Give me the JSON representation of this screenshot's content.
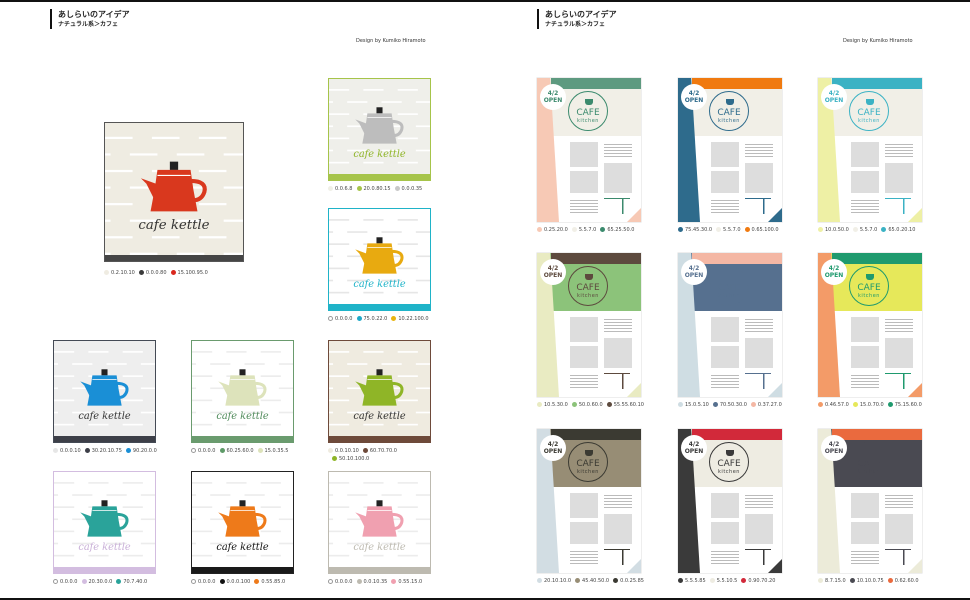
{
  "pages": [
    {
      "title": "あしらいのアイデア",
      "subtitle": "ナチュラル系＞カフェ",
      "credit": "Design by Kumiko Hiramoto"
    },
    {
      "title": "あしらいのアイデア",
      "subtitle": "ナチュラル系＞カフェ",
      "credit": "Design by Kumiko Hiramoto"
    }
  ],
  "kettle_text": "cafe kettle",
  "kettle_cards": [
    {
      "bg": "#efece2",
      "border": "#555555",
      "bar": "#454545",
      "stripe": "#ffffff",
      "kettle": "#d9381e",
      "text": "#333333",
      "big": true,
      "colors": [
        {
          "c": "#efece2",
          "v": "0.2.10.10"
        },
        {
          "c": "#3a3a3a",
          "v": "0.0.0.80"
        },
        {
          "c": "#d9281e",
          "v": "15.100.95.0"
        }
      ]
    },
    {
      "bg": "#efefea",
      "border": "#a6c44a",
      "bar": "#a6c44a",
      "stripe": "#ffffff",
      "kettle": "#bdbdbd",
      "text": "#8fb527",
      "colors": [
        {
          "c": "#efefe6",
          "v": "0.0.6.8"
        },
        {
          "c": "#a6c44a",
          "v": "20.0.80.15"
        },
        {
          "c": "#c8c8c8",
          "v": "0.0.0.35"
        }
      ]
    },
    {
      "bg": "#ffffff",
      "border": "#1fb3c8",
      "bar": "#1fb3c8",
      "stripe": "#e6e6e6",
      "kettle": "#e8aa10",
      "text": "#1fb3c8",
      "colors": [
        {
          "c": "#ffffff",
          "v": "0.0.0.0"
        },
        {
          "c": "#1fa8c8",
          "v": "75.0.22.0"
        },
        {
          "c": "#e8b410",
          "v": "10.22.100.0"
        }
      ]
    },
    {
      "bg": "#eeeeee",
      "border": "#444a55",
      "bar": "#3d3f48",
      "stripe": "#ffffff",
      "kettle": "#1a8fd6",
      "text": "#333333",
      "colors": [
        {
          "c": "#e6e6e6",
          "v": "0.0.0.10"
        },
        {
          "c": "#3d3f48",
          "v": "30.20.10.75"
        },
        {
          "c": "#1a8fd6",
          "v": "90.20.0.0"
        }
      ]
    },
    {
      "bg": "#ffffff",
      "border": "#6a9b6e",
      "bar": "#6a9b6e",
      "stripe": "#ececec",
      "kettle": "#dde3bb",
      "text": "#4f8a5a",
      "colors": [
        {
          "c": "#ffffff",
          "v": "0.0.0.0"
        },
        {
          "c": "#5e9a68",
          "v": "60.25.60.0"
        },
        {
          "c": "#dde3bb",
          "v": "15.0.35.5"
        }
      ]
    },
    {
      "bg": "#efebe0",
      "border": "#6e4a3a",
      "bar": "#6e4a3a",
      "stripe": "#ffffff",
      "kettle": "#8fb527",
      "text": "#333333",
      "colors": [
        {
          "c": "#efebe0",
          "v": "0.0.10.10"
        },
        {
          "c": "#6e4a3a",
          "v": "60.70.70.0"
        },
        {
          "c": "#8fb527",
          "v": "50.10.100.0"
        }
      ]
    },
    {
      "bg": "#ffffff",
      "border": "#d3bde0",
      "bar": "#d3bde0",
      "stripe": "#ececec",
      "kettle": "#2aa39a",
      "text": "#c9b0d8",
      "colors": [
        {
          "c": "#ffffff",
          "v": "0.0.0.0"
        },
        {
          "c": "#d3bde0",
          "v": "20.30.0.0"
        },
        {
          "c": "#2aa39a",
          "v": "70.7.40.0"
        }
      ]
    },
    {
      "bg": "#ffffff",
      "border": "#222222",
      "bar": "#1a1a1a",
      "stripe": "#ececec",
      "kettle": "#ee7a1a",
      "text": "#111111",
      "colors": [
        {
          "c": "#ffffff",
          "v": "0.0.0.0"
        },
        {
          "c": "#111111",
          "v": "0.0.0.100"
        },
        {
          "c": "#ee7a1a",
          "v": "0.55.85.0"
        }
      ]
    },
    {
      "bg": "#ffffff",
      "border": "#bdbab0",
      "bar": "#bdbab0",
      "stripe": "#ececec",
      "kettle": "#f0a0b0",
      "text": "#bdbab0",
      "colors": [
        {
          "c": "#ffffff",
          "v": "0.0.0.0"
        },
        {
          "c": "#bdbab0",
          "v": "0.0.10.35"
        },
        {
          "c": "#f0a0b0",
          "v": "0.55.15.0"
        }
      ]
    }
  ],
  "poster_text": {
    "date": "4/2",
    "open": "OPEN",
    "cafe": "CAFE",
    "kitchen": "kitchen"
  },
  "posters": [
    {
      "left": "#f7c9b5",
      "top": "#5e9a80",
      "head": "#f1efe7",
      "accent": "#3b8a6d",
      "colors": [
        {
          "c": "#f7c9b5",
          "v": "0.25.20.0"
        },
        {
          "c": "#f1efe7",
          "v": "5.5.7.0"
        },
        {
          "c": "#3b8a6d",
          "v": "65.25.50.0"
        }
      ]
    },
    {
      "left": "#2e6b8c",
      "top": "#f07a10",
      "head": "#f1efe7",
      "accent": "#2e6b8c",
      "colors": [
        {
          "c": "#2e6b8c",
          "v": "75.45.30.0"
        },
        {
          "c": "#f1efe7",
          "v": "5.5.7.0"
        },
        {
          "c": "#f07a10",
          "v": "0.65.100.0"
        }
      ]
    },
    {
      "left": "#eef0a5",
      "top": "#3bb2c4",
      "head": "#f1efe7",
      "accent": "#3bb2c4",
      "colors": [
        {
          "c": "#eef0a5",
          "v": "10.0.50.0"
        },
        {
          "c": "#f1efe7",
          "v": "5.5.7.0"
        },
        {
          "c": "#3bb2c4",
          "v": "65.0.20.10"
        }
      ]
    },
    {
      "left": "#e9ebc2",
      "top": "#5d4a3e",
      "head": "#8cc37a",
      "accent": "#5d4a3e",
      "colors": [
        {
          "c": "#e9ebc2",
          "v": "10.5.30.0"
        },
        {
          "c": "#8cc37a",
          "v": "50.0.60.0"
        },
        {
          "c": "#5d4a3e",
          "v": "55.55.60.10"
        }
      ]
    },
    {
      "left": "#cfdde3",
      "top": "#f4b7a4",
      "head": "#56708f",
      "accent": "#56708f",
      "colors": [
        {
          "c": "#cfdde3",
          "v": "15.0.5.10"
        },
        {
          "c": "#56708f",
          "v": "70.50.30.0"
        },
        {
          "c": "#f4b7a4",
          "v": "0.37.27.0"
        }
      ]
    },
    {
      "left": "#f39b68",
      "top": "#1f9a6e",
      "head": "#e6e85a",
      "accent": "#1f9a6e",
      "colors": [
        {
          "c": "#f39b68",
          "v": "0.46.57.0"
        },
        {
          "c": "#e6e85a",
          "v": "15.0.70.0"
        },
        {
          "c": "#1f9a6e",
          "v": "75.15.60.0"
        }
      ]
    },
    {
      "left": "#d2dde3",
      "top": "#3b3a32",
      "head": "#978d75",
      "accent": "#3b3a32",
      "colors": [
        {
          "c": "#d2dde3",
          "v": "20.10.10.0"
        },
        {
          "c": "#978d75",
          "v": "45.40.50.0"
        },
        {
          "c": "#3b3a32",
          "v": "0.0.25.85"
        }
      ]
    },
    {
      "left": "#3a3a3a",
      "top": "#d2293a",
      "head": "#eeece2",
      "accent": "#3a3a3a",
      "colors": [
        {
          "c": "#3a3a3a",
          "v": "5.5.5.85"
        },
        {
          "c": "#eeece2",
          "v": "5.5.10.5"
        },
        {
          "c": "#d2293a",
          "v": "0.90.70.20"
        }
      ]
    },
    {
      "left": "#ecebd9",
      "top": "#ea6a3e",
      "head": "#4a4a52",
      "accent": "#4a4a52",
      "colors": [
        {
          "c": "#ecebd9",
          "v": "8.7.15.0"
        },
        {
          "c": "#4a4a52",
          "v": "10.10.0.75"
        },
        {
          "c": "#ea6a3e",
          "v": "0.62.60.0"
        }
      ]
    }
  ]
}
